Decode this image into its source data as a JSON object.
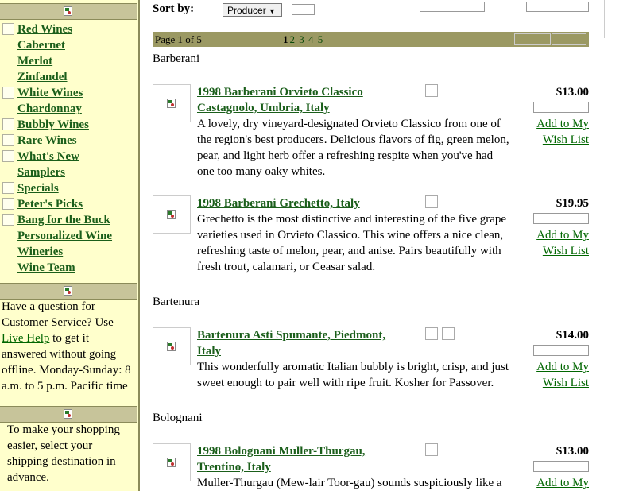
{
  "sidebar": {
    "nav": [
      {
        "label": "Red Wines",
        "checkbox": true
      },
      {
        "label": "Cabernet",
        "checkbox": false
      },
      {
        "label": "Merlot",
        "checkbox": false
      },
      {
        "label": "Zinfandel",
        "checkbox": false
      },
      {
        "label": "White Wines",
        "checkbox": true
      },
      {
        "label": "Chardonnay",
        "checkbox": false
      },
      {
        "label": "Bubbly Wines",
        "checkbox": true
      },
      {
        "label": "Rare Wines",
        "checkbox": true
      },
      {
        "label": "What's New",
        "checkbox": true
      },
      {
        "label": "Samplers",
        "checkbox": false
      },
      {
        "label": "Specials",
        "checkbox": true
      },
      {
        "label": "Peter's Picks",
        "checkbox": true
      },
      {
        "label": "Bang for the Buck",
        "checkbox": true
      },
      {
        "label": "Personalized Wine",
        "checkbox": false
      },
      {
        "label": "Wineries",
        "checkbox": false
      },
      {
        "label": "Wine Team",
        "checkbox": false
      }
    ],
    "help": {
      "line1": "Have a question for",
      "line2": "Customer Service? Use",
      "link": "Live Help",
      "line3_rest": " to get it",
      "line4": "answered without going",
      "line5": "offline. Monday-Sunday: 8",
      "line6": "a.m. to 5 p.m. Pacific time"
    },
    "shipping": {
      "line1": "To make your shopping",
      "line2": "easier, select your",
      "line3": "shipping destination in",
      "line4": "advance."
    }
  },
  "toolbar": {
    "sort_label": "Sort by:",
    "sort_value": "Producer"
  },
  "pagination": {
    "label": "Page 1 of 5",
    "current": "1",
    "pages": [
      "2",
      "3",
      "4",
      "5"
    ]
  },
  "groups": [
    {
      "producer": "Barberani",
      "products": [
        {
          "title_line1": "1998 Barberani Orvieto Classico",
          "title_line2": "Castagnolo, Umbria, Italy",
          "price": "$13.00",
          "desc": [
            "A lovely, dry vineyard-designated Orvieto Classico from one of",
            "the region's best producers. Delicious flavors of fig, green melon,",
            "pear, and light herb offer a refreshing respite when you've had",
            "one too many oaky whites."
          ],
          "wish_line1": "Add to My",
          "wish_line2": "Wish List"
        },
        {
          "title_line1": "1998 Barberani Grechetto, Italy",
          "title_line2": "",
          "price": "$19.95",
          "desc": [
            "Grechetto is the most distinctive and interesting of the five grape",
            "varieties used in Orvieto Classico. This wine offers a nice clean,",
            "refreshing taste of melon, pear, and anise. Pairs beautifully with",
            "fresh trout, calamari, or Ceasar salad."
          ],
          "wish_line1": "Add to My",
          "wish_line2": "Wish List"
        }
      ]
    },
    {
      "producer": "Bartenura",
      "products": [
        {
          "title_line1": "Bartenura Asti Spumante, Piedmont,",
          "title_line2": "Italy",
          "price": "$14.00",
          "desc": [
            "This wonderfully aromatic Italian bubbly is bright, crisp, and just",
            "sweet enough to pair well with ripe fruit. Kosher for Passover."
          ],
          "wish_line1": "Add to My",
          "wish_line2": "Wish List"
        }
      ]
    },
    {
      "producer": "Bolognani",
      "products": [
        {
          "title_line1": "1998 Bolognani Muller-Thurgau,",
          "title_line2": "Trentino, Italy",
          "price": "$13.00",
          "desc": [
            "Muller-Thurgau (Mew-lair Toor-gau) sounds suspiciously like a"
          ],
          "wish_line1": "Add to My",
          "wish_line2": ""
        }
      ]
    }
  ]
}
